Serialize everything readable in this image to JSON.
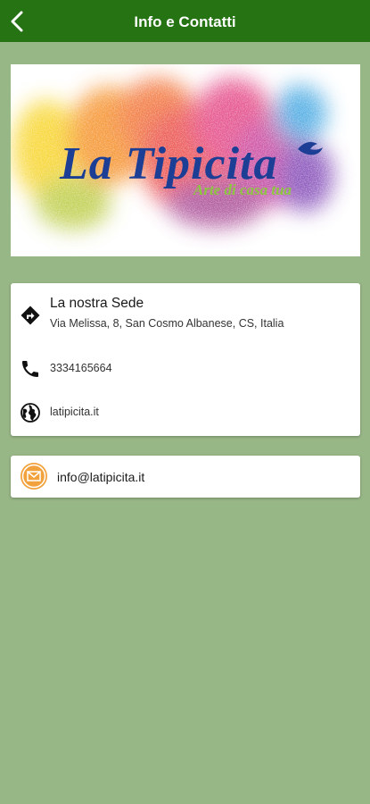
{
  "header": {
    "title": "Info e Contatti",
    "back_icon": "chevron-left-icon"
  },
  "colors": {
    "navbar": "#267314",
    "background": "#98b787",
    "card": "#ffffff",
    "email_icon": "#f2a23c"
  },
  "logo": {
    "brand_text": "La Tipicita",
    "tagline": "Arte di casa tua"
  },
  "contacts": {
    "sede": {
      "icon": "directions-icon",
      "title": "La nostra Sede",
      "address": "Via Melissa, 8, San Cosmo Albanese, CS, Italia"
    },
    "phone": {
      "icon": "phone-icon",
      "value": "3334165664"
    },
    "website": {
      "icon": "globe-icon",
      "value": "latipicita.it"
    }
  },
  "email": {
    "icon": "mail-icon",
    "value": "info@latipicita.it"
  }
}
